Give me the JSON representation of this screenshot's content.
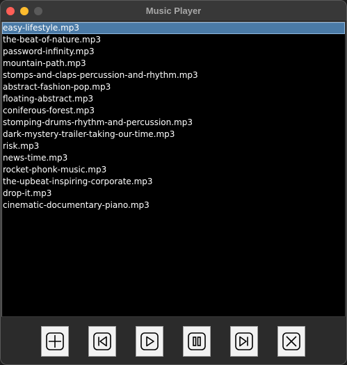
{
  "window": {
    "title": "Music Player"
  },
  "playlist": {
    "selected_index": 0,
    "tracks": [
      "easy-lifestyle.mp3",
      "the-beat-of-nature.mp3",
      "password-infinity.mp3",
      "mountain-path.mp3",
      "stomps-and-claps-percussion-and-rhythm.mp3",
      "abstract-fashion-pop.mp3",
      "floating-abstract.mp3",
      "coniferous-forest.mp3",
      "stomping-drums-rhythm-and-percussion.mp3",
      "dark-mystery-trailer-taking-our-time.mp3",
      "risk.mp3",
      "news-time.mp3",
      "rocket-phonk-music.mp3",
      "the-upbeat-inspiring-corporate.mp3",
      "drop-it.mp3",
      "cinematic-documentary-piano.mp3"
    ]
  },
  "controls": {
    "buttons": [
      {
        "name": "add-button",
        "icon": "plus-icon"
      },
      {
        "name": "previous-button",
        "icon": "skip-back-icon"
      },
      {
        "name": "play-button",
        "icon": "play-icon"
      },
      {
        "name": "pause-button",
        "icon": "pause-icon"
      },
      {
        "name": "next-button",
        "icon": "skip-forward-icon"
      },
      {
        "name": "remove-button",
        "icon": "close-x-icon"
      }
    ]
  },
  "colors": {
    "selection": "#4a7aa6",
    "list_background": "#000000",
    "title_text": "#a8a8a8",
    "close_light": "#ff5f57",
    "minimize_light": "#febc2e"
  }
}
